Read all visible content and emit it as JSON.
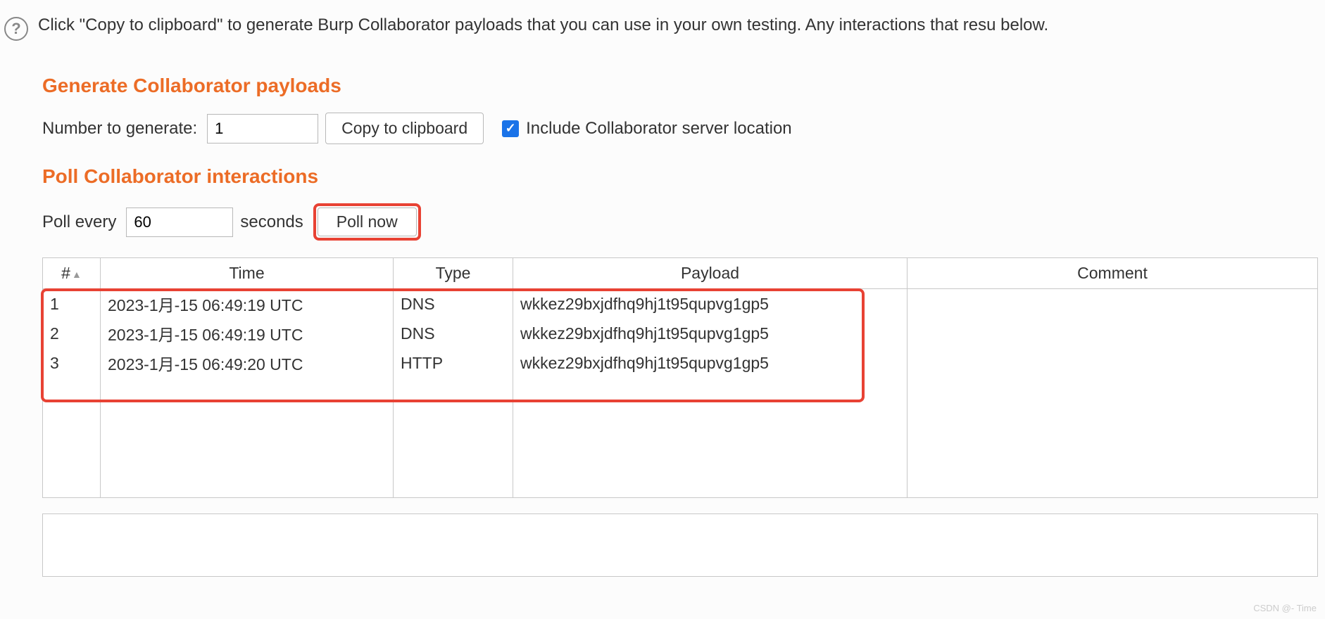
{
  "description": "Click \"Copy to clipboard\" to generate Burp Collaborator payloads that you can use in your own testing. Any interactions that resu below.",
  "generate": {
    "title": "Generate Collaborator payloads",
    "number_label": "Number to generate:",
    "number_value": "1",
    "copy_button": "Copy to clipboard",
    "include_label": "Include Collaborator server location"
  },
  "poll": {
    "title": "Poll Collaborator interactions",
    "every_label": "Poll every",
    "every_value": "60",
    "seconds_label": "seconds",
    "poll_now_button": "Poll now"
  },
  "table": {
    "headers": {
      "num": "#",
      "time": "Time",
      "type": "Type",
      "payload": "Payload",
      "comment": "Comment"
    },
    "rows": [
      {
        "num": "1",
        "time": "2023-1月-15 06:49:19 UTC",
        "type": "DNS",
        "payload": "wkkez29bxjdfhq9hj1t95qupvg1gp5",
        "comment": ""
      },
      {
        "num": "2",
        "time": "2023-1月-15 06:49:19 UTC",
        "type": "DNS",
        "payload": "wkkez29bxjdfhq9hj1t95qupvg1gp5",
        "comment": ""
      },
      {
        "num": "3",
        "time": "2023-1月-15 06:49:20 UTC",
        "type": "HTTP",
        "payload": "wkkez29bxjdfhq9hj1t95qupvg1gp5",
        "comment": ""
      }
    ]
  },
  "watermark": "CSDN @- Time"
}
